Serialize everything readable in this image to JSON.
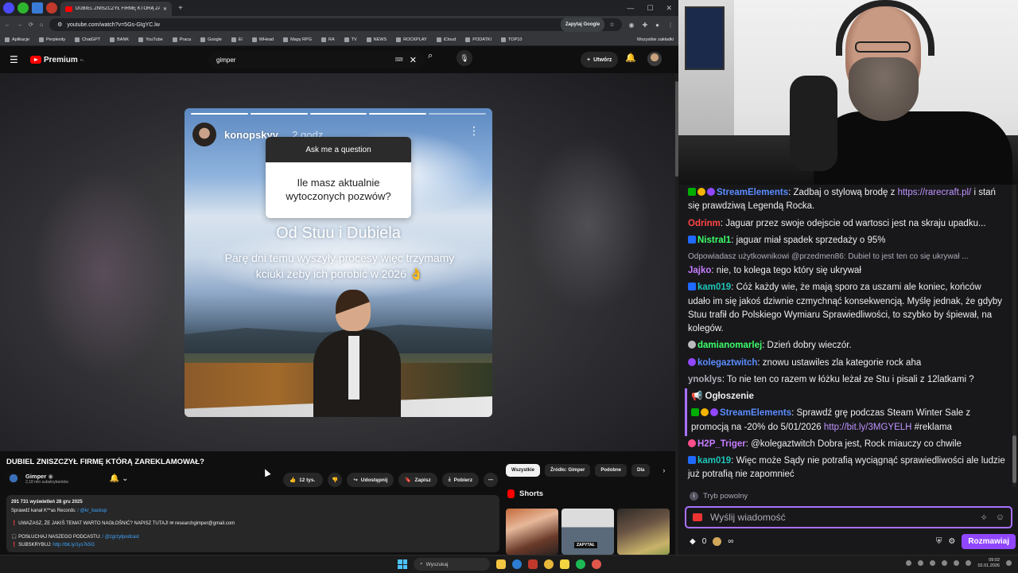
{
  "browser": {
    "tab_title": "DUBIEL ZNISZCZYŁ FIRMĘ KTÓRĄ ZAREKLAMOWAŁ? - YouTube",
    "url": "youtube.com/watch?v=5Gs-GIgYC.lw",
    "ask_google": "Zapytaj Google",
    "bookmarks": [
      "Aplikacje",
      "Perplexity",
      "ChatGPT",
      "BANK",
      "YouTube",
      "Praca",
      "Google",
      "El",
      "WHead",
      "Mapy RPG",
      "RA",
      "TV",
      "NEWS",
      "ROCKPLAY",
      "iCloud",
      "PODATKI",
      "TOP10"
    ],
    "all_bookmarks": "Wszystkie zakładki"
  },
  "youtube": {
    "logo_text": "Premium",
    "logo_sup": "PL",
    "search_value": "gimper",
    "create_label": "Utwórz",
    "video_title": "DUBIEL ZNISZCZYŁ FIRMĘ KTÓRĄ ZAREKLAMOWAŁ?",
    "channel_name": "Gimper",
    "channel_subs": "2,18 mln subskrybentów",
    "like_count": "12 tys.",
    "share_label": "Udostępnij",
    "save_label": "Zapisz",
    "download_label": "Pobierz",
    "chips": [
      "Wszystkie",
      "Źródło: Gimper",
      "Podobne",
      "Dla"
    ],
    "shorts_label": "Shorts",
    "thumb2_tag": "ZAPYTAŁ",
    "description": {
      "stats": "291 731 wyświetleń  28 gru 2025",
      "line1": "Sprawdź kanał K**as Records: ",
      "line1_link": "/ @kr_backup",
      "line2": "❗ UWAŻASZ, ŻE JAKIŚ TEMAT WARTO NAGŁOŚNIĆ? NAPISZ TUTAJ! ✉ researchgimper@gmail.com",
      "line3": "🎧 POSŁUCHAJ NASZEGO PODCASTU: ",
      "line3_link": "/ @zgrzytpodcast",
      "line4": "❗ SUBSKRYBUJ: ",
      "line4_link": "http://bit.ly/1ys7k5G"
    }
  },
  "story": {
    "username": "konopskyy_",
    "time": "2 godz.",
    "question_header": "Ask me a question",
    "question_text": "Ile masz aktualnie wytoczonych pozwów?",
    "line1": "Od Stuu i Dubiela",
    "line2": "Parę dni temu wyszyły procesy więc trzymamy kciuki żeby ich porobić w 2026 👌"
  },
  "chat": {
    "messages": [
      {
        "user": "StreamElements",
        "text": ": Zadbaj o stylową brodę z ",
        "link": "https://rarecraft.pl/",
        "tail": " i stań się prawdziwą Legendą Rocka."
      },
      {
        "user": "Odrinm",
        "text": ": Jaguar przez swoje odejscie od wartosci jest na skraju upadku..."
      },
      {
        "user": "Nistral1",
        "text": ": jaguar miał spadek sprzedaży o 95% "
      },
      {
        "reply": "Odpowiadasz użytkownikowi @przedmen86: Dubiel to jest ten co się ukrywał ..."
      },
      {
        "user": "Jajko",
        "text": ": nie, to kolega tego który się ukrywał"
      },
      {
        "user": "kam019",
        "text": ": Cóż każdy wie, że mają sporo za uszami ale koniec, końców udało im się jakoś dziwnie czmychnąć konsekwencją. Myślę jednak, że gdyby Stuu trafił do Polskiego Wymiaru Sprawiedliwości, to szybko by śpiewał, na kolegów."
      },
      {
        "user": "damianomarlej",
        "text": ": Dzień dobry wieczór."
      },
      {
        "user": "kolegaztwitch",
        "text": ": znowu ustawiles zla kategorie rock aha"
      },
      {
        "user": "ynoklys",
        "text": ": To nie ten co razem w łóżku leżał ze Stu i pisali z 12latkami ?"
      },
      {
        "announcement": "Ogłoszenie"
      },
      {
        "user": "StreamElements",
        "text": ": Sprawdź grę podczas Steam Winter Sale z promocją na -20% do 5/01/2026 ",
        "link": "http://bit.ly/3MGYELH",
        "tail": " #reklama"
      },
      {
        "user": "H2P_Triger",
        "text": ": @kolegaztwitch Dobra jest, Rock miauczy co chwile"
      },
      {
        "user": "kam019",
        "text": ": Więc może Sądy nie potrafią wyciągnąć sprawiedliwości ale ludzie już potrafią nie zapomnieć"
      }
    ],
    "slow_mode": "Tryb powolny",
    "input_placeholder": "Wyślij wiadomość",
    "points": "0",
    "send_label": "Rozmawiaj"
  },
  "taskbar": {
    "search_label": "Wyszukaj",
    "time": "09:02",
    "date": "02.01.2026"
  },
  "colors": {
    "accent_purple": "#9147ff",
    "youtube_red": "#ff0000",
    "link_blue": "#3ea6ff"
  }
}
